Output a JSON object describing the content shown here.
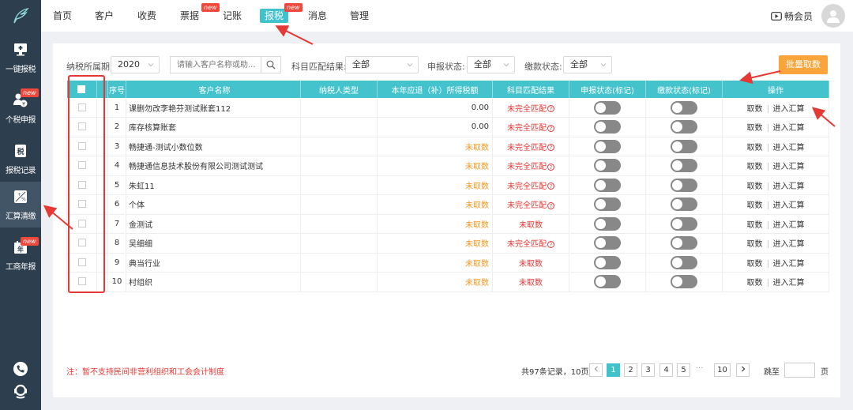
{
  "sidebar": {
    "items": [
      {
        "label": "一键报税",
        "icon": "monitor-icon",
        "new": false
      },
      {
        "label": "个税申报",
        "icon": "person-tax-icon",
        "new": true
      },
      {
        "label": "报税记录",
        "icon": "tax-record-icon",
        "new": false
      },
      {
        "label": "汇算清缴",
        "icon": "calculator-icon",
        "new": false,
        "active": true
      },
      {
        "label": "工商年报",
        "icon": "annual-report-icon",
        "new": true
      }
    ],
    "bottom_icons": [
      "phone-icon",
      "support-headset-icon"
    ]
  },
  "badge_text": "new",
  "topnav": {
    "items": [
      {
        "label": "首页"
      },
      {
        "label": "客户"
      },
      {
        "label": "收费"
      },
      {
        "label": "票据",
        "new": true
      },
      {
        "label": "记账"
      },
      {
        "label": "报税",
        "new": true,
        "active": true
      },
      {
        "label": "消息"
      },
      {
        "label": "管理"
      }
    ],
    "vip_label": "畅会员"
  },
  "filters": {
    "period_label": "纳税所属期:",
    "period_value": "2020",
    "search_placeholder": "请输入客户名称或助...",
    "match_label": "科目匹配结果:",
    "match_value": "全部",
    "declare_label": "申报状态:",
    "declare_value": "全部",
    "pay_label": "缴款状态:",
    "pay_value": "全部",
    "batch_button": "批量取数"
  },
  "table": {
    "headers": [
      "序号",
      "客户名称",
      "纳税人类型",
      "本年应退（补）所得税额",
      "科目匹配结果",
      "申报状态(标记)",
      "缴款状态(标记)",
      "操作"
    ],
    "op_fetch": "取数",
    "op_enter": "进入汇算",
    "rows": [
      {
        "no": "1",
        "name": "课删勿改李艳芬测试账套112",
        "type": "",
        "amount": "0.00",
        "amount_status": "number",
        "match": "未完全匹配",
        "match_help": true
      },
      {
        "no": "2",
        "name": "库存核算账套",
        "type": "",
        "amount": "0.00",
        "amount_status": "number",
        "match": "未完全匹配",
        "match_help": true
      },
      {
        "no": "3",
        "name": "畅捷通-测试小数位数",
        "type": "",
        "amount": "未取数",
        "amount_status": "pending",
        "match": "未完全匹配",
        "match_help": true
      },
      {
        "no": "4",
        "name": "畅捷通信息技术股份有限公司测试测试",
        "type": "",
        "amount": "未取数",
        "amount_status": "pending",
        "match": "未完全匹配",
        "match_help": true
      },
      {
        "no": "5",
        "name": "朱虹11",
        "type": "",
        "amount": "未取数",
        "amount_status": "pending",
        "match": "未完全匹配",
        "match_help": true
      },
      {
        "no": "6",
        "name": "个体",
        "type": "",
        "amount": "未取数",
        "amount_status": "pending",
        "match": "未完全匹配",
        "match_help": true
      },
      {
        "no": "7",
        "name": "金测试",
        "type": "",
        "amount": "未取数",
        "amount_status": "pending",
        "match": "未取数",
        "match_help": false
      },
      {
        "no": "8",
        "name": "吴细细",
        "type": "",
        "amount": "未取数",
        "amount_status": "pending",
        "match": "未完全匹配",
        "match_help": true
      },
      {
        "no": "9",
        "name": "典当行业",
        "type": "",
        "amount": "未取数",
        "amount_status": "pending",
        "match": "未取数",
        "match_help": false
      },
      {
        "no": "10",
        "name": "村组织",
        "type": "",
        "amount": "未取数",
        "amount_status": "pending",
        "match": "未取数",
        "match_help": false
      }
    ]
  },
  "footnote": "注：暂不支持民间非营利组织和工会会计制度",
  "pagination": {
    "total_text": "共97条记录，10页",
    "pages": [
      "1",
      "2",
      "3",
      "4",
      "5"
    ],
    "ellipsis": "···",
    "last_page": "10",
    "current": "1",
    "jump_label": "跳至",
    "page_unit": "页"
  },
  "colors": {
    "sidebar_bg": "#2d3e4e",
    "accent_teal": "#3fc2cc",
    "header_teal": "#44c3cd",
    "batch_orange": "#f9a53b",
    "warning_red": "#e53935",
    "pending_orange": "#f59a23"
  }
}
